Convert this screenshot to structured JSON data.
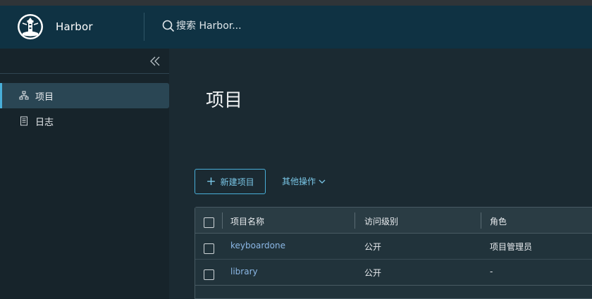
{
  "header": {
    "brand": "Harbor",
    "search_placeholder": "搜索 Harbor..."
  },
  "sidebar": {
    "items": [
      {
        "label": "项目",
        "icon": "projects-icon",
        "active": true
      },
      {
        "label": "日志",
        "icon": "logs-icon",
        "active": false
      }
    ]
  },
  "main": {
    "title": "项目",
    "new_button": "新建项目",
    "more_actions": "其他操作"
  },
  "table": {
    "columns": [
      "项目名称",
      "访问级别",
      "角色"
    ],
    "rows": [
      {
        "name": "keyboardone",
        "access": "公开",
        "role": "项目管理员"
      },
      {
        "name": "library",
        "access": "公开",
        "role": "-"
      }
    ]
  },
  "colors": {
    "header_bg": "#0f3243",
    "accent": "#49afd9",
    "link": "#8cb8e6"
  }
}
